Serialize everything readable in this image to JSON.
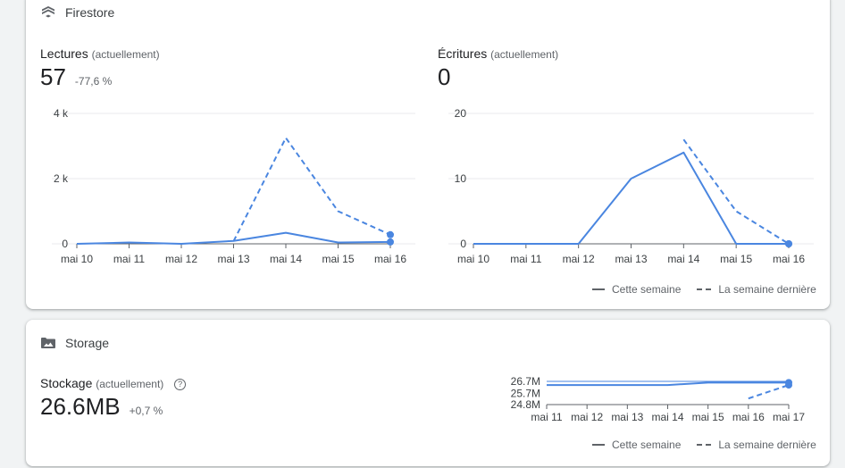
{
  "firestore": {
    "title": "Firestore",
    "icon": "firestore-icon",
    "reads": {
      "label": "Lectures",
      "sublabel": "(actuellement)",
      "value": "57",
      "delta": "-77,6 %"
    },
    "writes": {
      "label": "Écritures",
      "sublabel": "(actuellement)",
      "value": "0"
    },
    "legend": {
      "current": "Cette semaine",
      "previous": "La semaine dernière"
    }
  },
  "storage": {
    "title": "Storage",
    "icon": "image-folder-icon",
    "stock": {
      "label": "Stockage",
      "sublabel": "(actuellement)",
      "value": "26.6MB",
      "delta": "+0,7 %"
    },
    "legend": {
      "current": "Cette semaine",
      "previous": "La semaine dernière"
    }
  },
  "colors": {
    "series": "#4a86e0",
    "grid": "#e8eaed",
    "axis": "#5f6368"
  },
  "chart_data": [
    {
      "id": "reads",
      "type": "line",
      "categories": [
        "mai 10",
        "mai 11",
        "mai 12",
        "mai 13",
        "mai 14",
        "mai 15",
        "mai 16"
      ],
      "yticks": [
        0,
        2000,
        4000
      ],
      "ytick_labels": [
        "0",
        "2 k",
        "4 k"
      ],
      "ylim": [
        0,
        4000
      ],
      "series": [
        {
          "name": "Cette semaine",
          "style": "solid",
          "values": [
            0,
            40,
            0,
            90,
            340,
            40,
            57
          ]
        },
        {
          "name": "La semaine dernière",
          "style": "dashed",
          "values": [
            null,
            null,
            null,
            80,
            3250,
            1000,
            280
          ]
        }
      ]
    },
    {
      "id": "writes",
      "type": "line",
      "categories": [
        "mai 10",
        "mai 11",
        "mai 12",
        "mai 13",
        "mai 14",
        "mai 15",
        "mai 16"
      ],
      "yticks": [
        0,
        10,
        20
      ],
      "ytick_labels": [
        "0",
        "10",
        "20"
      ],
      "ylim": [
        0,
        20
      ],
      "series": [
        {
          "name": "Cette semaine",
          "style": "solid",
          "values": [
            0,
            0,
            0,
            10,
            14,
            0,
            0
          ]
        },
        {
          "name": "La semaine dernière",
          "style": "dashed",
          "values": [
            null,
            null,
            null,
            null,
            16,
            5,
            0
          ]
        }
      ]
    },
    {
      "id": "storage",
      "type": "line",
      "categories": [
        "mai 11",
        "mai 12",
        "mai 13",
        "mai 14",
        "mai 15",
        "mai 16",
        "mai 17"
      ],
      "yticks": [
        24.8,
        25.7,
        26.7
      ],
      "ytick_labels": [
        "24.8M",
        "25.7M",
        "26.7M"
      ],
      "ylim": [
        24.8,
        26.7
      ],
      "series": [
        {
          "name": "Cette semaine",
          "style": "solid",
          "values": [
            26.4,
            26.4,
            26.4,
            26.4,
            26.6,
            26.6,
            26.6
          ]
        },
        {
          "name": "La semaine dernière",
          "style": "dashed",
          "values": [
            null,
            null,
            null,
            null,
            null,
            25.3,
            26.4
          ]
        }
      ]
    }
  ]
}
